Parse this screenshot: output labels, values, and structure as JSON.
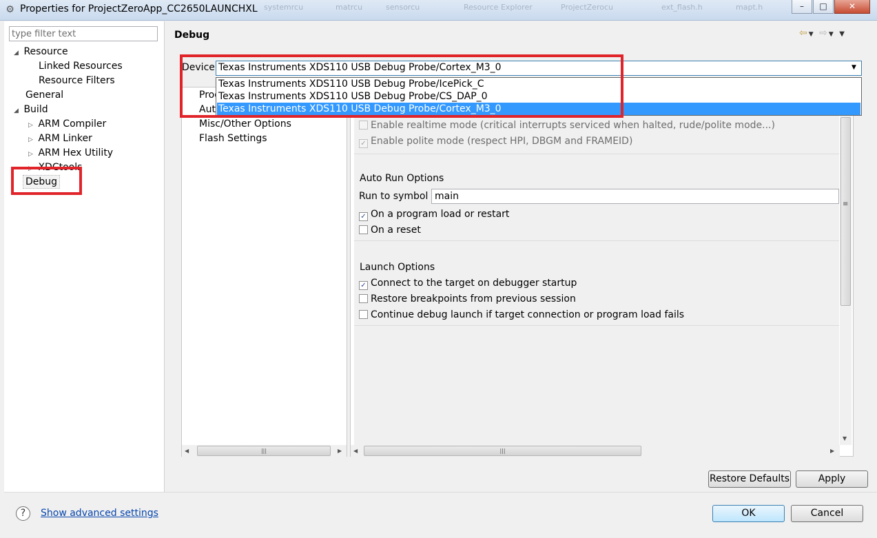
{
  "window": {
    "title": "Properties for ProjectZeroApp_CC2650LAUNCHXL",
    "minimize_glyph": "–",
    "maximize_glyph": "□",
    "close_glyph": "✕",
    "background_tabs": [
      "systemrcu",
      "matrcu",
      "sensorcu",
      "Resource Explorer",
      "ProjectZerocu",
      "ext_flash.h",
      "mapt.h"
    ]
  },
  "sidebar": {
    "filter_placeholder": "type filter text",
    "tree": {
      "resource": "Resource",
      "linked_resources": "Linked Resources",
      "resource_filters": "Resource Filters",
      "general": "General",
      "build": "Build",
      "arm_compiler": "ARM Compiler",
      "arm_linker": "ARM Linker",
      "arm_hex_utility": "ARM Hex Utility",
      "xdctools": "XDCtools",
      "debug": "Debug"
    }
  },
  "page": {
    "title": "Debug",
    "device_label": "Device",
    "device_value": "Texas Instruments XDS110 USB Debug Probe/Cortex_M3_0",
    "device_options": [
      "Texas Instruments XDS110 USB Debug Probe/IcePick_C",
      "Texas Instruments XDS110 USB Debug Probe/CS_DAP_0",
      "Texas Instruments XDS110 USB Debug Probe/Cortex_M3_0"
    ],
    "selected_option_index": 2
  },
  "categories": {
    "item1": "Prog",
    "item2": "Aut",
    "item3": "Misc/Other Options",
    "item4": "Flash Settings"
  },
  "options": {
    "realtime_label": "Enable realtime mode (critical interrupts serviced when halted, rude/polite mode...)",
    "realtime_checked": false,
    "polite_label": "Enable polite mode (respect HPI, DBGM and FRAMEID)",
    "polite_checked": true,
    "auto_run": {
      "title": "Auto Run Options",
      "run_to_symbol_label": "Run to symbol",
      "run_to_symbol_value": "main",
      "on_load_label": "On a program load or restart",
      "on_load_checked": true,
      "on_reset_label": "On a reset",
      "on_reset_checked": false
    },
    "launch": {
      "title": "Launch Options",
      "connect_label": "Connect to the target on debugger startup",
      "connect_checked": true,
      "restore_label": "Restore breakpoints from previous session",
      "restore_checked": false,
      "continue_label": "Continue debug launch if target connection or program load fails",
      "continue_checked": false
    }
  },
  "buttons": {
    "restore_defaults": "Restore Defaults",
    "apply": "Apply",
    "ok": "OK",
    "cancel": "Cancel"
  },
  "footer": {
    "help_glyph": "?",
    "advanced_link": "Show advanced settings"
  },
  "colors": {
    "highlight_box": "#e0242a",
    "selection": "#3399ff",
    "link": "#0645ad"
  }
}
